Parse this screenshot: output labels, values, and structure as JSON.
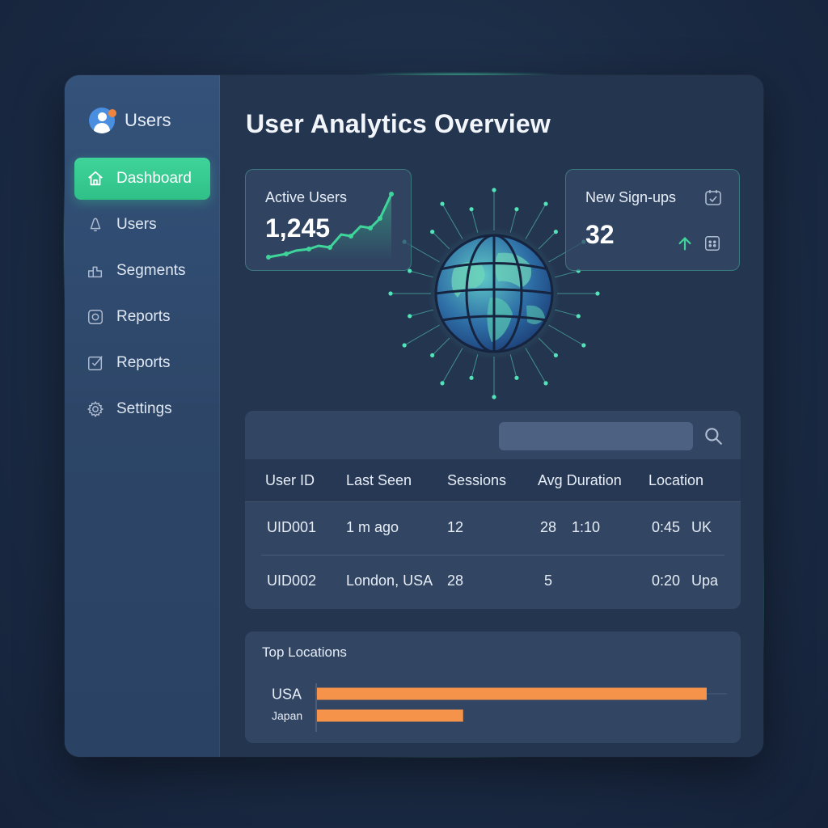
{
  "brand": {
    "label": "Users"
  },
  "sidebar": {
    "items": [
      {
        "label": "Dashboard",
        "icon": "home-icon",
        "active": true
      },
      {
        "label": "Users",
        "icon": "bell-icon"
      },
      {
        "label": "Segments",
        "icon": "segments-icon"
      },
      {
        "label": "Reports",
        "icon": "instagram-icon"
      },
      {
        "label": "Reports",
        "icon": "checkbox-icon"
      },
      {
        "label": "Settings",
        "icon": "gear-icon"
      }
    ]
  },
  "page": {
    "title": "User Analytics Overview"
  },
  "cards": {
    "active_users": {
      "label": "Active Users",
      "value": "1,245"
    },
    "new_signups": {
      "label": "New Sign-ups",
      "value": "32"
    }
  },
  "table": {
    "search": {
      "placeholder": ""
    },
    "headers": [
      "User ID",
      "Last Seen",
      "Sessions",
      "Avg Duration",
      "Location"
    ],
    "rows": [
      [
        "UID001",
        "1 m ago",
        "12",
        "28",
        "1:10",
        "0:45",
        "UK"
      ],
      [
        "UID002",
        "London, USA",
        "28",
        "5",
        "",
        "0:20",
        "Upa"
      ]
    ]
  },
  "top_locations": {
    "title": "Top Locations"
  },
  "chart_data": {
    "type": "bar",
    "orientation": "horizontal",
    "title": "Top Locations",
    "categories": [
      "USA",
      "Japan"
    ],
    "values": [
      100,
      37.5
    ],
    "xlim": [
      0,
      100
    ],
    "bar_color": "#f5934a"
  },
  "colors": {
    "accent": "#3fd49a",
    "bar": "#f5934a",
    "brand_dot": "#f0843c"
  }
}
